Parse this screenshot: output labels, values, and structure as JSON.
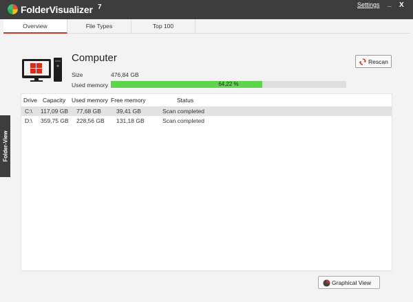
{
  "app": {
    "name": "FolderVisualizer",
    "version": "7"
  },
  "titlebar": {
    "settings_label": "Settings",
    "minimize_label": "_",
    "close_label": "X"
  },
  "tabs": [
    {
      "label": "Overview",
      "active": true
    },
    {
      "label": "File Types",
      "active": false
    },
    {
      "label": "Top 100",
      "active": false
    }
  ],
  "side_tab": {
    "label": "Folder-View"
  },
  "computer": {
    "title": "Computer",
    "size_label": "Size",
    "size_value": "476,84 GB",
    "used_memory_label": "Used memory",
    "used_memory_percent_text": "64,22 %",
    "used_memory_fraction": 0.6422
  },
  "rescan_button": {
    "label": "Rescan",
    "icon": "rescan-icon"
  },
  "drives_table": {
    "columns": [
      "Drive",
      "Capacity",
      "Used memory",
      "Free memory",
      "Status"
    ],
    "rows": [
      {
        "drive": "C:\\",
        "capacity": "117,09 GB",
        "used": "77,68 GB",
        "free": "39,41 GB",
        "status": "Scan completed",
        "selected": true
      },
      {
        "drive": "D:\\",
        "capacity": "359,75 GB",
        "used": "228,56 GB",
        "free": "131,18 GB",
        "status": "Scan completed",
        "selected": false
      }
    ]
  },
  "graphical_view_button": {
    "label": "Graphical View",
    "icon": "pie-chart-icon"
  },
  "colors": {
    "titlebar": "#3d3d3d",
    "progress": "#5fd54d",
    "accent": "#c0392b"
  }
}
